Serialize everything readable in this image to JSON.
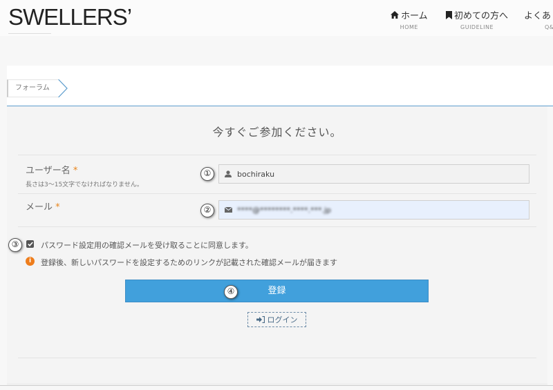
{
  "header": {
    "logo": "SWELLERS’",
    "nav": [
      {
        "label": "ホーム",
        "sub": "HOME",
        "icon": "home-icon"
      },
      {
        "label": "初めての方へ",
        "sub": "GUIDELINE",
        "icon": "bookmark-icon"
      },
      {
        "label": "よくあ",
        "sub": "Q&"
      }
    ]
  },
  "breadcrumb": {
    "current": "フォーラム"
  },
  "form": {
    "title": "今すぐご参加ください。",
    "username": {
      "label": "ユーザー名",
      "required_mark": "*",
      "hint": "長さは3〜15文字でなければなりません。",
      "value": "bochiraku",
      "icon": "user-icon"
    },
    "email": {
      "label": "メール",
      "required_mark": "*",
      "value": "****@********.****.***.jp",
      "icon": "envelope-icon"
    },
    "consent_label": "パスワード設定用の確認メールを受け取ることに同意します。",
    "info_text": "登録後、新しいパスワードを設定するためのリンクが記載された確認メールが届きます",
    "submit_label": "登録",
    "login_label": "ログイン"
  },
  "annotations": [
    "①",
    "②",
    "③",
    "④"
  ],
  "colors": {
    "accent": "#41a0dc",
    "required": "#e8841a",
    "info": "#ee7d1c"
  }
}
